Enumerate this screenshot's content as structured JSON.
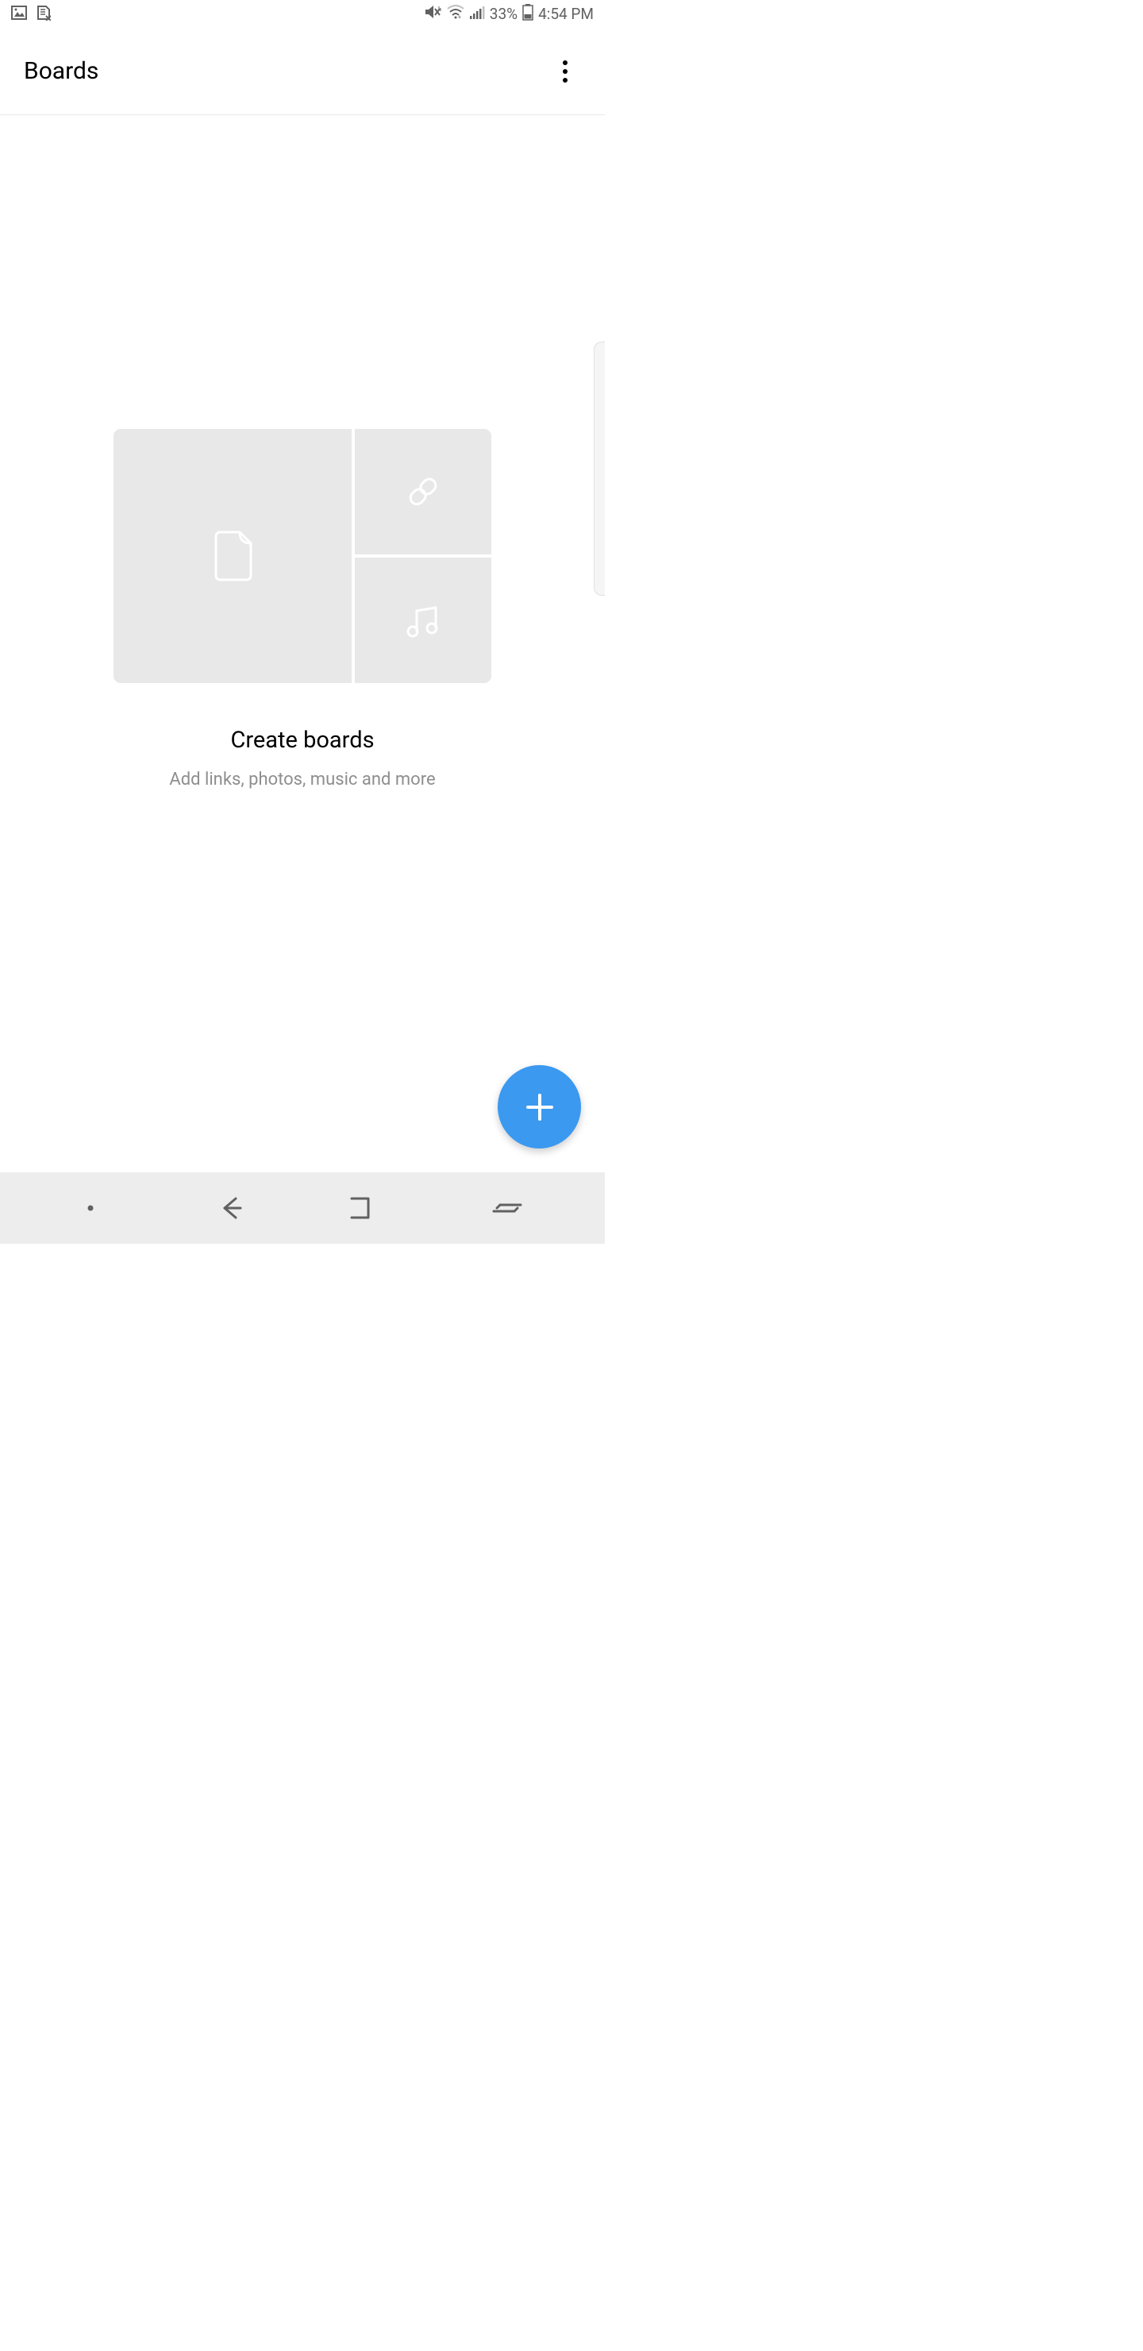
{
  "status_bar": {
    "battery_percent": "33%",
    "time": "4:54 PM"
  },
  "app_bar": {
    "title": "Boards"
  },
  "empty_state": {
    "title": "Create boards",
    "subtitle": "Add links, photos, music and more"
  },
  "icons": {
    "picture": "picture-icon",
    "sim": "sim-icon",
    "mute": "mute-icon",
    "wifi": "wifi-icon",
    "signal": "signal-icon",
    "battery": "battery-icon",
    "more": "more-icon",
    "file": "file-icon",
    "link": "link-icon",
    "music": "music-icon",
    "plus": "plus-icon",
    "back": "back-icon",
    "home": "home-icon",
    "recents": "recents-icon"
  }
}
